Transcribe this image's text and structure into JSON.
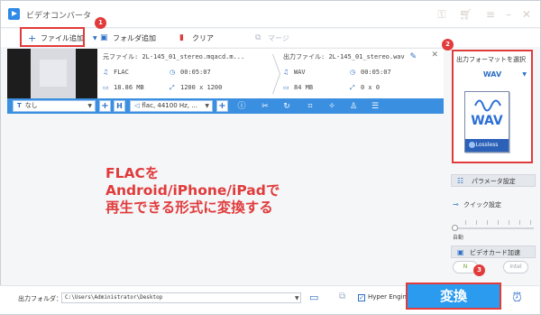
{
  "app": {
    "title": "ビデオコンバータ"
  },
  "toolbar": {
    "add_file": "ファイル追加",
    "add_folder": "フォルダ追加",
    "clear": "クリア",
    "merge": "マージ"
  },
  "badges": {
    "b1": "1",
    "b2": "2",
    "b3": "3"
  },
  "file": {
    "source_label": "元ファイル:",
    "source_name": "2L-145_01_stereo.mqacd.m...",
    "source_format": "FLAC",
    "source_duration": "00:05:07",
    "source_size": "18.86 MB",
    "source_resolution": "1200 x 1200",
    "output_label": "出力ファイル:",
    "output_name": "2L-145_01_stereo.wav",
    "output_format": "WAV",
    "output_duration": "00:05:07",
    "output_size": "84 MB",
    "output_resolution": "0 x 0"
  },
  "editbar": {
    "subtitle": "なし",
    "audio": "flac, 44100 Hz, ..."
  },
  "caption": {
    "line1": "FLACを",
    "line2": "Android/iPhone/iPadで",
    "line3": "再生できる形式に変換する"
  },
  "format_panel": {
    "title": "出力フォーマットを選択",
    "selected": "WAV",
    "icon_label": "WAV",
    "icon_sublabel": "Lossless"
  },
  "right": {
    "params": "パラメータ設定",
    "quick": "クイック設定",
    "auto": "自動",
    "gpu": "ビデオカード加速",
    "gpu_nvidia": "N",
    "gpu_intel": "Intel"
  },
  "bottom": {
    "output_folder_label": "出力フォルダ：",
    "output_path": "C:\\Users\\Administrator\\Desktop",
    "hyper_engine": "Hyper Engine",
    "hyper_checked": "✓",
    "convert": "変換"
  },
  "colors": {
    "accent": "#2b9bf0",
    "highlight": "#e23b3b",
    "caption": "#e03b3b"
  },
  "icons": {
    "title": [
      "key-icon",
      "cart-icon",
      "menu-icon",
      "minimize-icon",
      "close-icon"
    ],
    "file": [
      "music-icon",
      "clock-icon",
      "folder-icon",
      "resize-icon"
    ]
  }
}
